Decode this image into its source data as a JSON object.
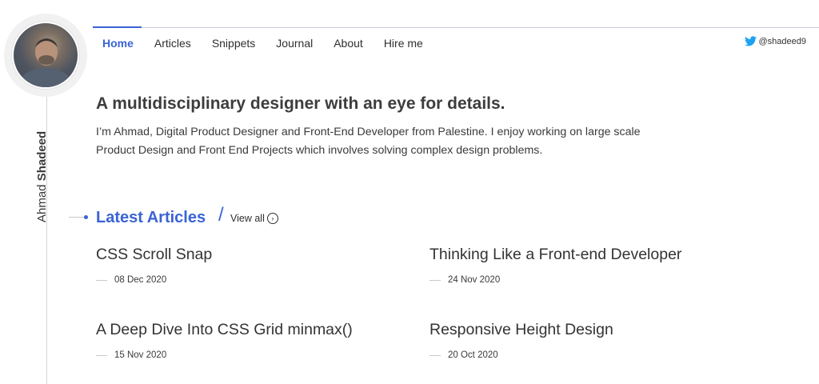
{
  "author": {
    "first_name": "Ahmad",
    "last_name": "Shadeed"
  },
  "nav": {
    "items": [
      {
        "label": "Home",
        "active": true
      },
      {
        "label": "Articles",
        "active": false
      },
      {
        "label": "Snippets",
        "active": false
      },
      {
        "label": "Journal",
        "active": false
      },
      {
        "label": "About",
        "active": false
      },
      {
        "label": "Hire me",
        "active": false
      }
    ],
    "accent_color": "#3a63d6"
  },
  "twitter": {
    "icon": "twitter-icon",
    "handle": "@shadeed9",
    "color": "#1da1f2"
  },
  "intro": {
    "headline": "A multidisciplinary designer with an eye for details.",
    "body": "I’m Ahmad, Digital Product Designer and Front-End Developer from Palestine. I enjoy working on large scale Product Design and Front End Projects which involves solving complex design problems."
  },
  "latest": {
    "title": "Latest Articles",
    "slash": "/",
    "view_all": "View all",
    "view_all_icon": "chevron-right-circle-icon",
    "articles": [
      {
        "title": "CSS Scroll Snap",
        "date": "08 Dec 2020"
      },
      {
        "title": "Thinking Like a Front-end Developer",
        "date": "24 Nov 2020"
      },
      {
        "title": "A Deep Dive Into CSS Grid minmax()",
        "date": "15 Nov 2020"
      },
      {
        "title": "Responsive Height Design",
        "date": "20 Oct 2020"
      }
    ]
  }
}
